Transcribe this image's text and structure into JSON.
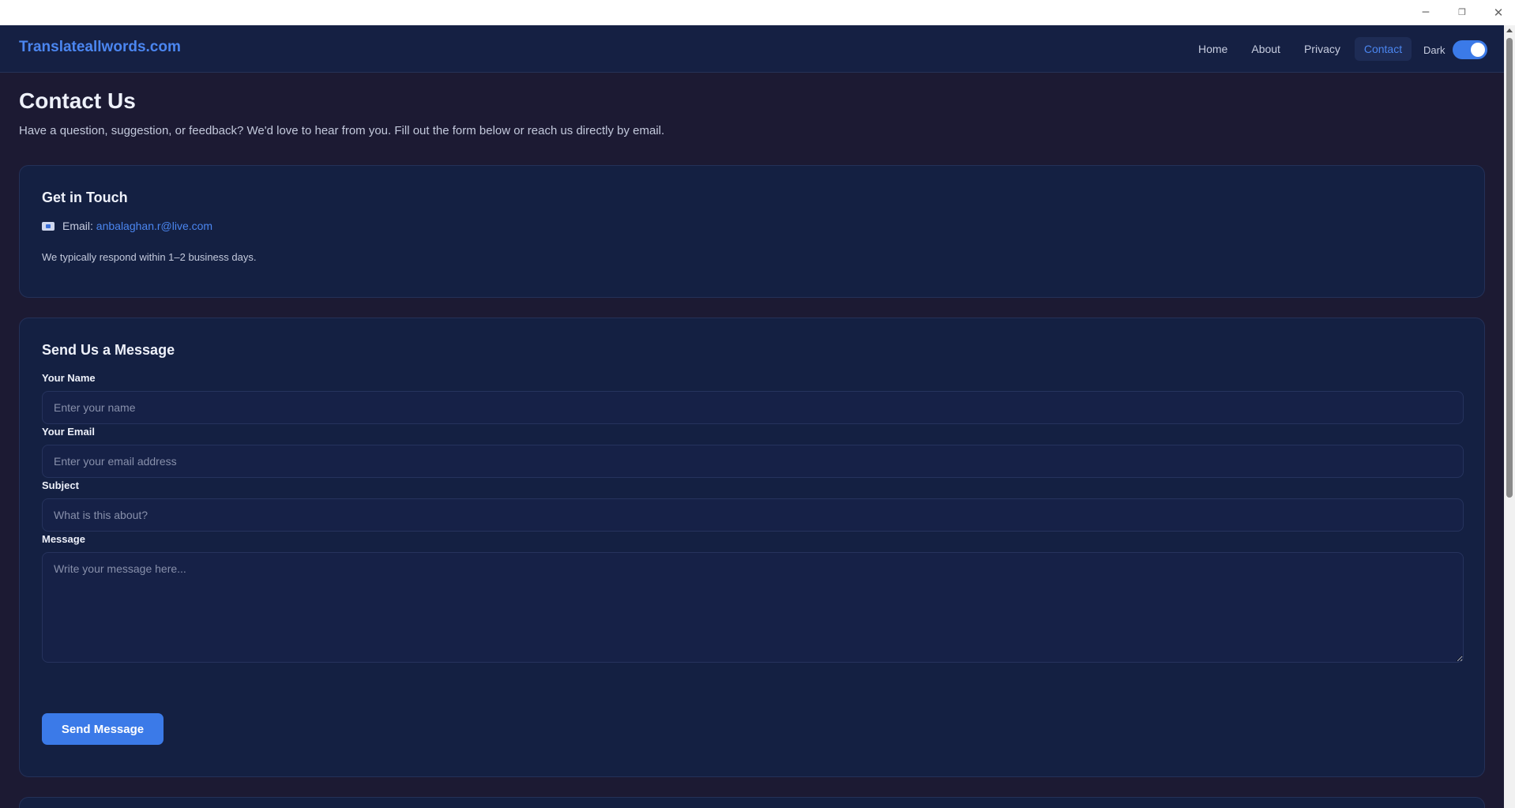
{
  "window": {
    "minimize_glyph": "─",
    "maximize_glyph": "❐",
    "close_glyph": "✕"
  },
  "header": {
    "brand": "Translateallwords.com",
    "nav": [
      {
        "label": "Home",
        "active": false
      },
      {
        "label": "About",
        "active": false
      },
      {
        "label": "Privacy",
        "active": false
      },
      {
        "label": "Contact",
        "active": true
      }
    ],
    "theme_label": "Dark",
    "theme_dark_on": true
  },
  "page": {
    "title": "Contact Us",
    "intro": "Have a question, suggestion, or feedback? We'd love to hear from you. Fill out the form below or reach us directly by email."
  },
  "touch": {
    "title": "Get in Touch",
    "email_label": "Email:",
    "email": "anbalaghan.r@live.com",
    "respond_note": "We typically respond within 1–2 business days."
  },
  "form": {
    "title": "Send Us a Message",
    "name_label": "Your Name",
    "name_placeholder": "Enter your name",
    "email_label": "Your Email",
    "email_placeholder": "Enter your email address",
    "subject_label": "Subject",
    "subject_placeholder": "What is this about?",
    "message_label": "Message",
    "message_placeholder": "Write your message here...",
    "submit_label": "Send Message"
  },
  "colors": {
    "background": "#1c1a33",
    "card": "#142042",
    "accent": "#3b7ae8",
    "link": "#4b86f0"
  }
}
